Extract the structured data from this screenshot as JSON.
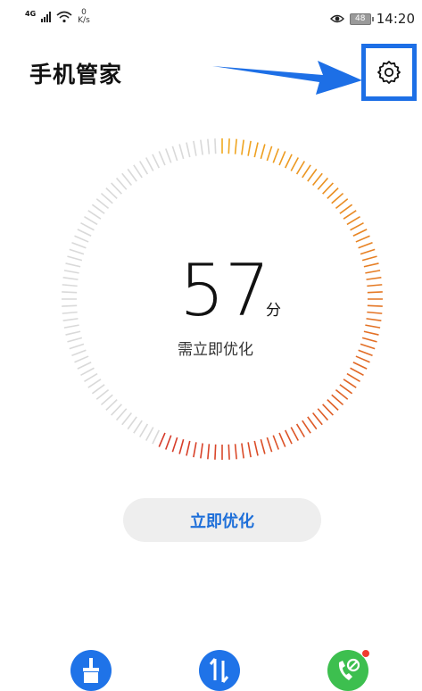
{
  "status_bar": {
    "network": "4G",
    "speed_value": "0",
    "speed_unit": "K/s",
    "battery": "48",
    "time": "14:20",
    "icons": [
      "signal-icon",
      "wifi-icon",
      "eye-icon",
      "battery-icon"
    ]
  },
  "header": {
    "title": "手机管家",
    "settings_icon": "gear-icon",
    "annotation_color": "#1d6fe6"
  },
  "score": {
    "value": "57",
    "unit": "分",
    "caption": "需立即优化",
    "fraction": 0.57
  },
  "actions": {
    "optimize_label": "立即优化"
  },
  "tools": [
    {
      "icon": "broom-icon",
      "color": "#1f73e8"
    },
    {
      "icon": "traffic-icon",
      "color": "#1f73e8"
    },
    {
      "icon": "call-block-icon",
      "color": "#3dbf4f",
      "badge": true
    }
  ],
  "colors": {
    "accent": "#1e6fd9",
    "gauge_start": "#f0a820",
    "gauge_end": "#d63a2a",
    "gauge_inactive": "#d9d9d9"
  }
}
